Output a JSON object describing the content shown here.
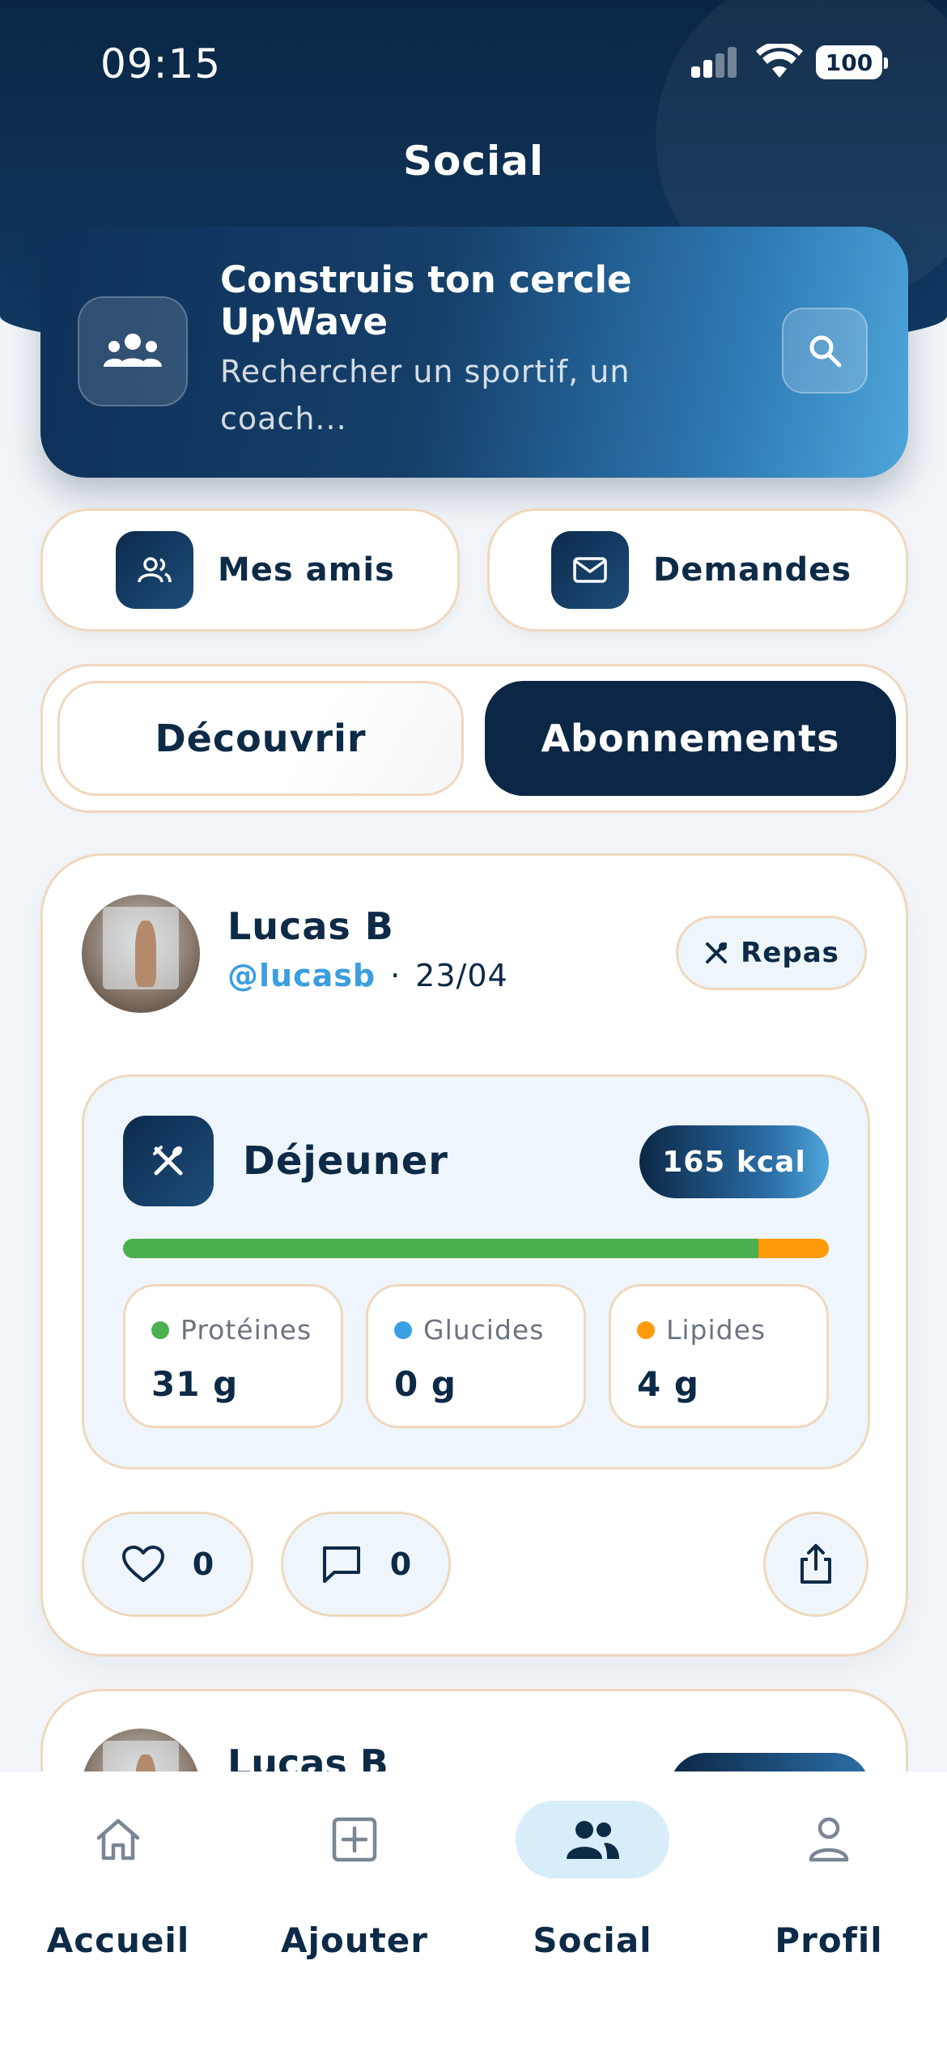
{
  "status_bar": {
    "time": "09:15",
    "battery": "100"
  },
  "header": {
    "title": "Social"
  },
  "search_card": {
    "headline": "Construis ton cercle UpWave",
    "subtitle": "Rechercher un sportif, un coach..."
  },
  "quick_actions": [
    {
      "label": "Mes amis",
      "icon": "friends-icon"
    },
    {
      "label": "Demandes",
      "icon": "mail-icon"
    }
  ],
  "feed_tabs": [
    {
      "label": "Découvrir",
      "active": false
    },
    {
      "label": "Abonnements",
      "active": true
    }
  ],
  "post": {
    "author": "Lucas B",
    "handle": "@lucasb",
    "separator": "·",
    "date": "23/04",
    "tag": "Repas",
    "meal": {
      "title": "Déjeuner",
      "kcal": "165 kcal",
      "macros": [
        {
          "label": "Protéines",
          "value": "31 g",
          "color": "#4caf50"
        },
        {
          "label": "Glucides",
          "value": "0 g",
          "color": "#3aa0e3"
        },
        {
          "label": "Lipides",
          "value": "4 g",
          "color": "#ff9b0a"
        }
      ],
      "macro_split": [
        {
          "name": "Protéines",
          "fraction": 0.9,
          "color": "#4caf50"
        },
        {
          "name": "Glucides",
          "fraction": 0.0,
          "color": "#3aa0e3"
        },
        {
          "name": "Lipides",
          "fraction": 0.1,
          "color": "#ff9b0a"
        }
      ]
    },
    "likes": "0",
    "comments": "0"
  },
  "post_next": {
    "author": "Lucas B"
  },
  "tab_bar": [
    {
      "label": "Accueil",
      "icon": "home-icon",
      "active": false
    },
    {
      "label": "Ajouter",
      "icon": "add-square-icon",
      "active": false
    },
    {
      "label": "Social",
      "icon": "social-icon",
      "active": true
    },
    {
      "label": "Profil",
      "icon": "profile-icon",
      "active": false
    }
  ]
}
